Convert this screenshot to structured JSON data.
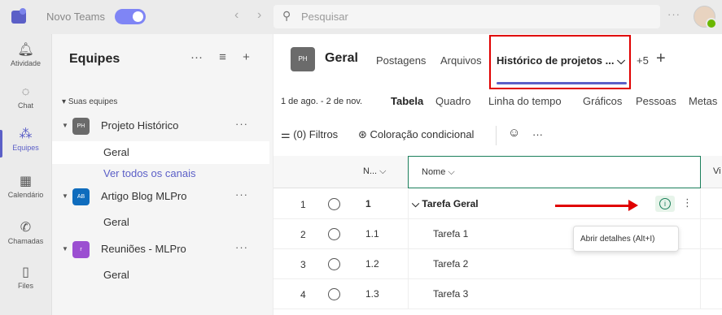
{
  "topbar": {
    "app_name": "Novo Teams",
    "search_placeholder": "Pesquisar",
    "more": "···"
  },
  "rail": [
    {
      "label": "Atividade",
      "icon": "bell-icon"
    },
    {
      "label": "Chat",
      "icon": "chat-icon"
    },
    {
      "label": "Equipes",
      "icon": "teams-icon"
    },
    {
      "label": "Calendário",
      "icon": "calendar-icon"
    },
    {
      "label": "Chamadas",
      "icon": "phone-icon"
    },
    {
      "label": "Files",
      "icon": "file-icon"
    }
  ],
  "pane": {
    "title": "Equipes",
    "section": "Suas equipes",
    "teams": [
      {
        "avatar": "PH",
        "name": "Projeto Histórico",
        "color": "#6b6b6b",
        "channels": [
          "Geral",
          "Ver todos os canais"
        ]
      },
      {
        "avatar": "AB",
        "name": "Artigo Blog MLPro",
        "color": "#0f6cbd",
        "channels": [
          "Geral"
        ]
      },
      {
        "avatar": "r",
        "name": "Reuniões - MLPro",
        "color": "#9b4fd1",
        "channels": [
          "Geral"
        ]
      }
    ]
  },
  "channel": {
    "avatar": "PH",
    "title": "Geral",
    "tabs": [
      "Postagens",
      "Arquivos",
      "Histórico de projetos ..."
    ],
    "overflow": "+5"
  },
  "subbar": {
    "date_range": "1 de ago. - 2 de nov.",
    "views": [
      "Tabela",
      "Quadro",
      "Linha do tempo",
      "Gráficos",
      "Pessoas",
      "Metas"
    ]
  },
  "toolbar": {
    "filters": "(0) Filtros",
    "conditional": "Coloração condicional"
  },
  "grid": {
    "col_n": "N... ⌵",
    "col_nome": "Nome ⌵",
    "col_vi": "Vi",
    "rows": [
      {
        "num": "1",
        "id": "1",
        "name": "⌵ Tarefa Geral",
        "bold": true
      },
      {
        "num": "2",
        "id": "1.1",
        "name": "Tarefa 1",
        "bold": false
      },
      {
        "num": "3",
        "id": "1.2",
        "name": "Tarefa 2",
        "bold": false
      },
      {
        "num": "4",
        "id": "1.3",
        "name": "Tarefa 3",
        "bold": false
      }
    ]
  },
  "tooltip": "Abrir detalhes (Alt+I)",
  "colors": {
    "accent": "#5b5fc7",
    "highlight": "#e00000",
    "green": "#1b7f5b"
  }
}
